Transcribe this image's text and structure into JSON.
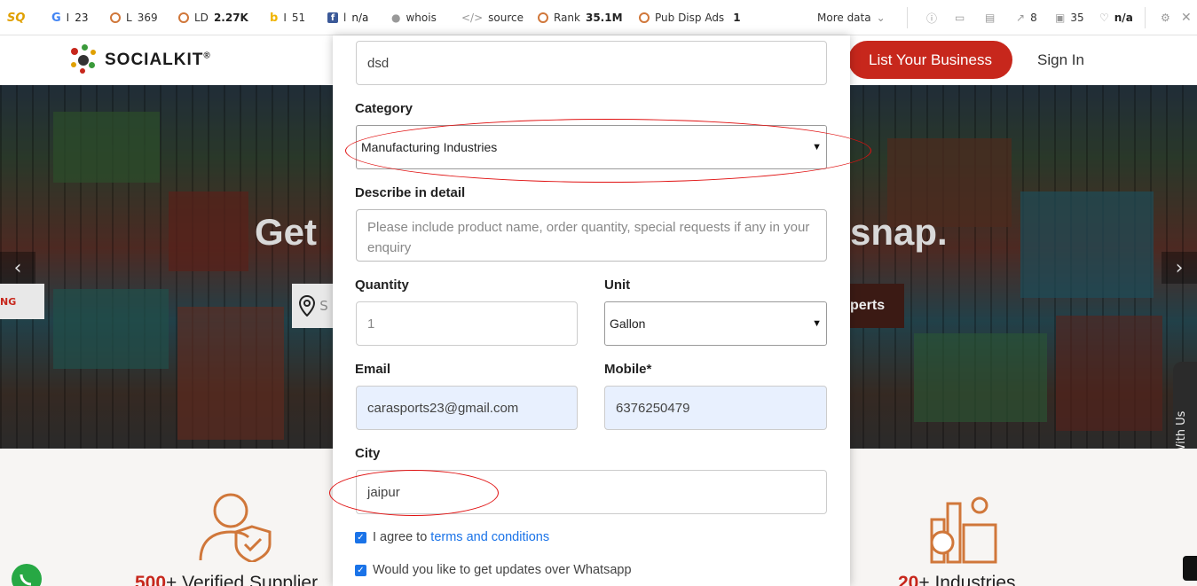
{
  "seo_bar": {
    "items": [
      {
        "icon": "google-icon",
        "label": "I",
        "value": "23"
      },
      {
        "icon": "circle-icon",
        "label": "L",
        "value": "369"
      },
      {
        "icon": "circle-icon",
        "label": "LD",
        "value": "2.27K"
      },
      {
        "icon": "bing-icon",
        "label": "I",
        "value": "51"
      },
      {
        "icon": "facebook-icon",
        "label": "l",
        "value": "n/a"
      },
      {
        "icon": "person-icon",
        "label": "whois",
        "value": ""
      },
      {
        "icon": "code-icon",
        "label": "source",
        "value": ""
      },
      {
        "icon": "circle-icon",
        "label": "Rank",
        "value": "35.1M"
      },
      {
        "icon": "circle-icon",
        "label": "Pub Disp Ads",
        "value": "1"
      }
    ],
    "more_data": "More data",
    "right_items": [
      {
        "icon": "external-link-icon",
        "value": "8"
      },
      {
        "icon": "page-icon",
        "value": "35"
      },
      {
        "icon": "heart-icon",
        "value": "n/a"
      }
    ]
  },
  "header": {
    "logo_text": "SOCIALKIT",
    "logo_reg": "®",
    "list_business": "List Your Business",
    "sign_in": "Sign In"
  },
  "hero": {
    "title_left": "Get",
    "title_right": "snap.",
    "experts_fragment": "perts",
    "search_fragment": "S",
    "left_tag": "NG",
    "chat_label": "Chat With Us"
  },
  "stats": {
    "left_num": "500",
    "left_text": "+ Verified Supplier",
    "right_num": "20",
    "right_text": "+ Industries"
  },
  "form": {
    "name_value": "dsd",
    "category_label": "Category",
    "category_value": "Manufacturing Industries",
    "describe_label": "Describe in detail",
    "describe_placeholder": "Please include product name, order quantity, special requests if any in your enquiry",
    "quantity_label": "Quantity",
    "quantity_value": "1",
    "unit_label": "Unit",
    "unit_value": "Gallon",
    "email_label": "Email",
    "email_value": "carasports23@gmail.com",
    "mobile_label": "Mobile*",
    "mobile_value": "6376250479",
    "city_label": "City",
    "city_value": "jaipur",
    "agree_prefix": "I agree to ",
    "agree_link": "terms and conditions",
    "whatsapp_text": "Would you like to get updates over Whatsapp"
  },
  "colors": {
    "brand_red": "#c7271c",
    "annotation_red": "#e01010",
    "autofill_blue": "#e8f0fe",
    "checkbox_blue": "#1a73e8"
  }
}
